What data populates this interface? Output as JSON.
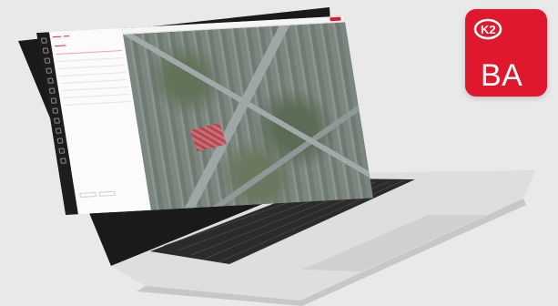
{
  "badge": {
    "code": "BA",
    "color": "#e0182d",
    "logo_icon": "k2-logo-icon"
  },
  "laptop": {
    "screen_content": "aerial-map-app",
    "left_rail_icons": [
      "grid-icon",
      "layers-icon",
      "pin-icon",
      "ruler-icon",
      "measure-icon",
      "settings-icon",
      "info-icon",
      "help-icon",
      "list-icon",
      "tools-icon",
      "user-icon",
      "chat-icon",
      "share-icon"
    ]
  }
}
